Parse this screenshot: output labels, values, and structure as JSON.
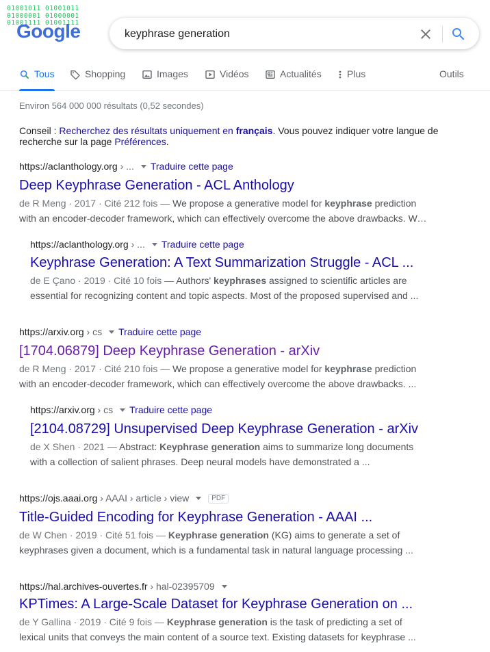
{
  "logo": {
    "binary_line1": "01001011  01001011",
    "binary_line2": "01000001  01000001",
    "binary_line3": "01001111  01001111",
    "word": "Google"
  },
  "search": {
    "query": "keyphrase generation"
  },
  "tabs": [
    {
      "label": "Tous",
      "icon": "search-icon",
      "active": true
    },
    {
      "label": "Shopping",
      "icon": "tag-icon"
    },
    {
      "label": "Images",
      "icon": "image-icon"
    },
    {
      "label": "Vidéos",
      "icon": "play-icon"
    },
    {
      "label": "Actualités",
      "icon": "news-icon"
    },
    {
      "label": "Plus",
      "icon": "more-vert-icon"
    }
  ],
  "tools_label": "Outils",
  "stats": "Environ 564 000 000 résultats (0,52 secondes)",
  "tip": {
    "prefix": "Conseil : ",
    "link1": "Recherchez des résultats uniquement en ",
    "link1_bold": "français",
    "middle": ". Vous pouvez indiquer votre langue de recherche sur la page ",
    "link2": "Préférences",
    "suffix": "."
  },
  "results": [
    {
      "domain": "https://aclanthology.org",
      "path": " › ...",
      "translate": "Traduire cette page",
      "title": "Deep Keyphrase Generation - ACL Anthology",
      "meta": "de R Meng · 2017 · Cité 212 fois — ",
      "s1": "We propose a generative model for ",
      "b1": "keyphrase",
      "s2": " prediction with an encoder-decoder framework, which can effectively overcome the above drawbacks. We ...",
      "b2": "",
      "s3": ""
    },
    {
      "domain": "https://aclanthology.org",
      "path": " › ...",
      "translate": "Traduire cette page",
      "title": "Keyphrase Generation: A Text Summarization Struggle - ACL ...",
      "meta": "de E Çano · 2019 · Cité 10 fois — ",
      "s1": "Authors' ",
      "b1": "keyphrases",
      "s2": " assigned to scientific articles are essential for recognizing content and topic aspects. Most of the proposed supervised and ...",
      "b2": "",
      "s3": ""
    },
    {
      "domain": "https://arxiv.org",
      "path": " › cs",
      "translate": "Traduire cette page",
      "title": "[1704.06879] Deep Keyphrase Generation - arXiv",
      "meta": "de R Meng · 2017 · Cité 210 fois — ",
      "s1": "We propose a generative model for ",
      "b1": "keyphrase",
      "s2": " prediction with an encoder-decoder framework, which can effectively overcome the above drawbacks. ...",
      "b2": "",
      "s3": ""
    },
    {
      "domain": "https://arxiv.org",
      "path": " › cs",
      "translate": "Traduire cette page",
      "title": "[2104.08729] Unsupervised Deep Keyphrase Generation - arXiv",
      "meta": "de X Shen · 2021 — ",
      "s1": "Abstract: ",
      "b1": "Keyphrase generation",
      "s2": " aims to summarize long documents with a collection of salient phrases. Deep neural models have demonstrated a ...",
      "b2": "",
      "s3": ""
    },
    {
      "domain": "https://ojs.aaai.org",
      "path": " › AAAI › article › view",
      "pdf": "PDF",
      "title": "Title-Guided Encoding for Keyphrase Generation - AAAI ...",
      "meta": "de W Chen · 2019 · Cité 51 fois — ",
      "s1": "",
      "b1": "Keyphrase generation",
      "s2": " (KG) aims to generate a set of keyphrases given a document, which is a fundamental task in natural language processing ...",
      "b2": "",
      "s3": ""
    },
    {
      "domain": "https://hal.archives-ouvertes.fr",
      "path": " › hal-02395709",
      "title": "KPTimes: A Large-Scale Dataset for Keyphrase Generation on ...",
      "meta": "de Y Gallina · 2019 · Cité 9 fois — ",
      "s1": "",
      "b1": "Keyphrase generation",
      "s2": " is the task of predicting a set of lexical units that conveys the main content of a source text. Existing datasets for keyphrase ...",
      "b2": "",
      "s3": ""
    }
  ]
}
